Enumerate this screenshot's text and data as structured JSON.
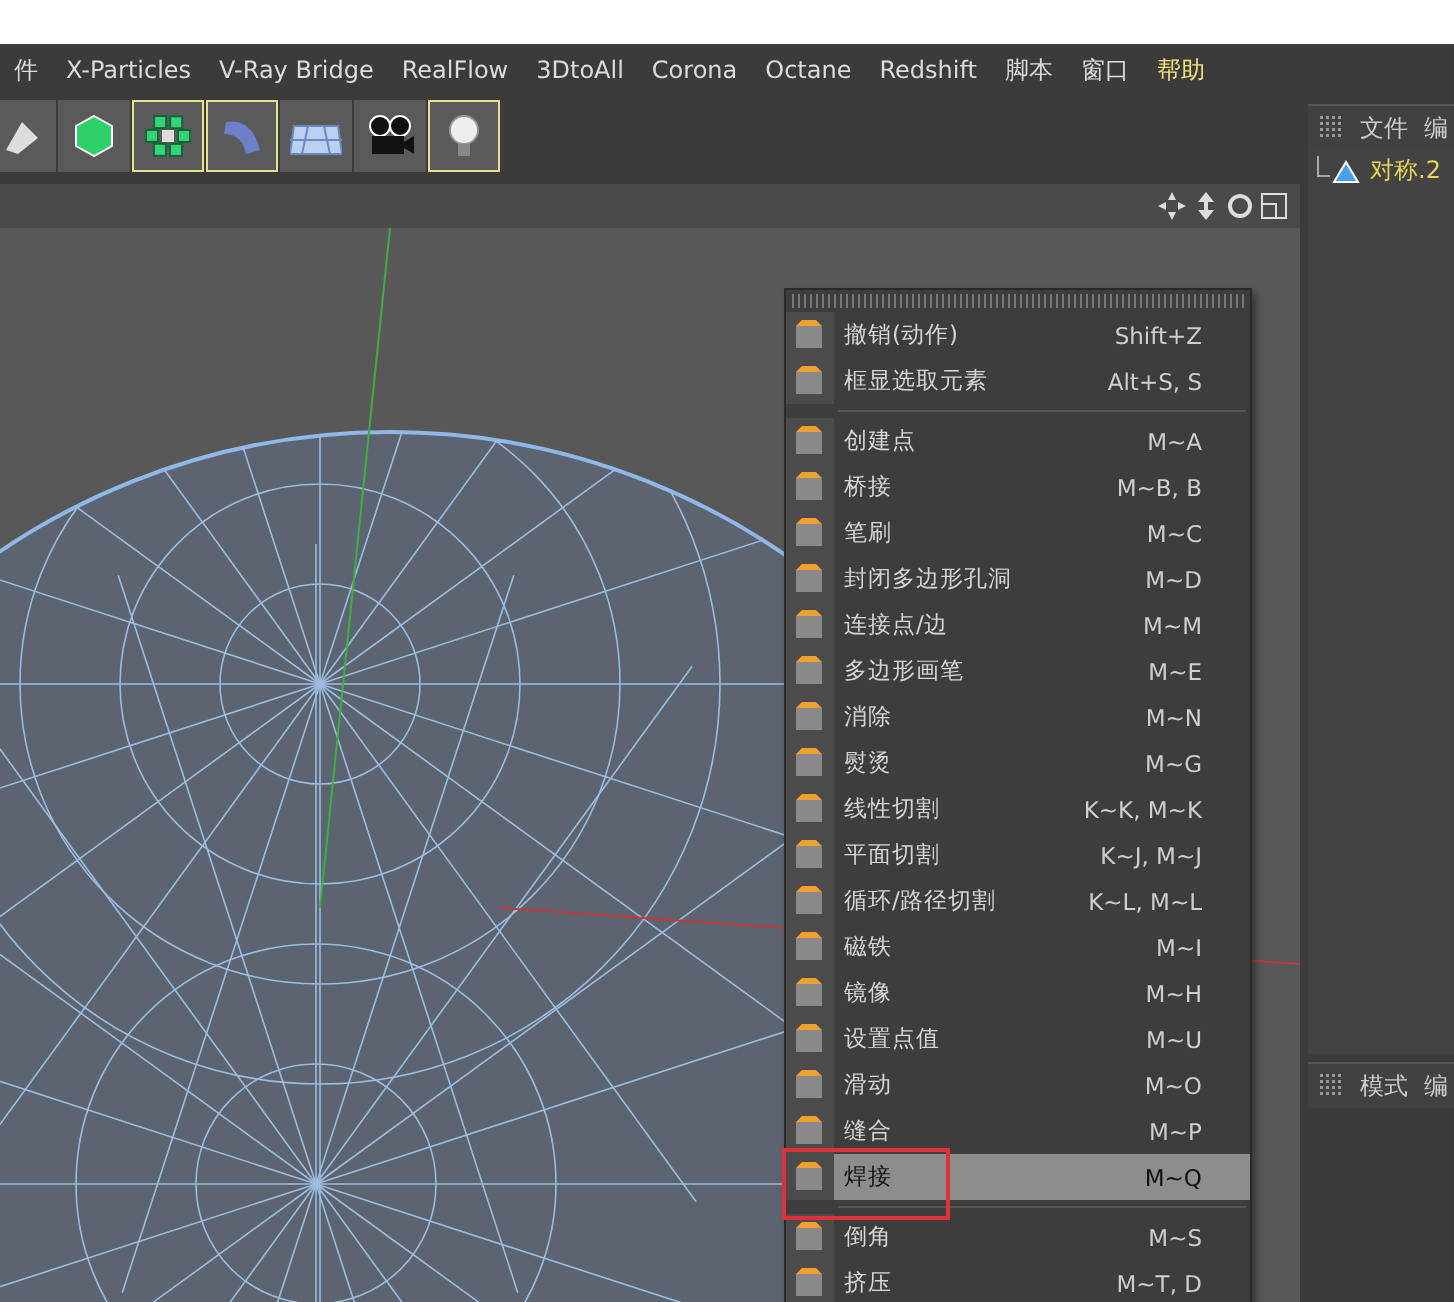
{
  "menu_bar": [
    {
      "label": "件",
      "highlighted": false
    },
    {
      "label": "X-Particles",
      "highlighted": false
    },
    {
      "label": "V-Ray Bridge",
      "highlighted": false
    },
    {
      "label": "RealFlow",
      "highlighted": false
    },
    {
      "label": "3DtoAll",
      "highlighted": false
    },
    {
      "label": "Corona",
      "highlighted": false
    },
    {
      "label": "Octane",
      "highlighted": false
    },
    {
      "label": "Redshift",
      "highlighted": false
    },
    {
      "label": "脚本",
      "highlighted": false
    },
    {
      "label": "窗口",
      "highlighted": false
    },
    {
      "label": "帮助",
      "highlighted": true
    }
  ],
  "toolbar": [
    {
      "kind": "pen",
      "selected": false
    },
    {
      "kind": "cube",
      "selected": false
    },
    {
      "kind": "cloner",
      "selected": true
    },
    {
      "kind": "bend",
      "selected": true
    },
    {
      "kind": "floor",
      "selected": false
    },
    {
      "kind": "camera",
      "selected": false
    },
    {
      "kind": "light",
      "selected": true
    }
  ],
  "object_manager": {
    "menu": [
      "文件",
      "编"
    ],
    "objects": [
      {
        "name": "对称.2"
      }
    ]
  },
  "attribute_manager": {
    "menu": [
      "模式",
      "编"
    ]
  },
  "context_menu": {
    "groups": [
      [
        {
          "label": "撤销(动作)",
          "shortcut": "Shift+Z",
          "selected": false
        },
        {
          "label": "框显选取元素",
          "shortcut": "Alt+S, S",
          "selected": false
        }
      ],
      [
        {
          "label": "创建点",
          "shortcut": "M~A",
          "selected": false
        },
        {
          "label": "桥接",
          "shortcut": "M~B, B",
          "selected": false
        },
        {
          "label": "笔刷",
          "shortcut": "M~C",
          "selected": false
        },
        {
          "label": "封闭多边形孔洞",
          "shortcut": "M~D",
          "selected": false
        },
        {
          "label": "连接点/边",
          "shortcut": "M~M",
          "selected": false
        },
        {
          "label": "多边形画笔",
          "shortcut": "M~E",
          "selected": false
        },
        {
          "label": "消除",
          "shortcut": "M~N",
          "selected": false
        },
        {
          "label": "熨烫",
          "shortcut": "M~G",
          "selected": false
        },
        {
          "label": "线性切割",
          "shortcut": "K~K, M~K",
          "selected": false
        },
        {
          "label": "平面切割",
          "shortcut": "K~J, M~J",
          "selected": false
        },
        {
          "label": "循环/路径切割",
          "shortcut": "K~L, M~L",
          "selected": false
        },
        {
          "label": "磁铁",
          "shortcut": "M~I",
          "selected": false
        },
        {
          "label": "镜像",
          "shortcut": "M~H",
          "selected": false
        },
        {
          "label": "设置点值",
          "shortcut": "M~U",
          "selected": false
        },
        {
          "label": "滑动",
          "shortcut": "M~O",
          "selected": false
        },
        {
          "label": "缝合",
          "shortcut": "M~P",
          "selected": false
        },
        {
          "label": "焊接",
          "shortcut": "M~Q",
          "selected": true
        }
      ],
      [
        {
          "label": "倒角",
          "shortcut": "M~S",
          "selected": false
        },
        {
          "label": "挤压",
          "shortcut": "M~T, D",
          "selected": false
        }
      ]
    ]
  }
}
